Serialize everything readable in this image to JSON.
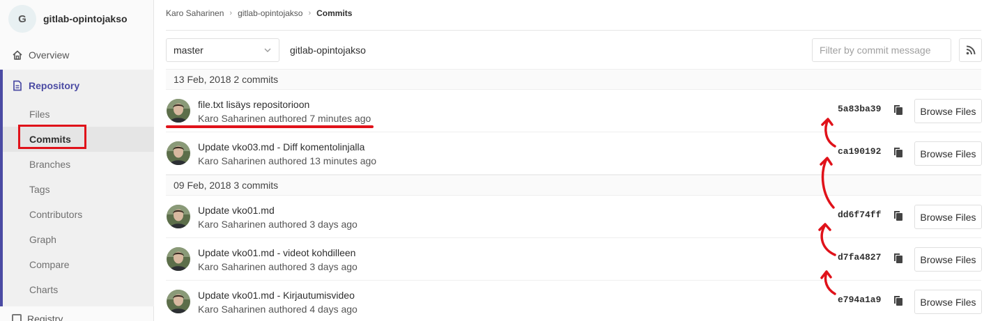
{
  "sidebar": {
    "project_initial": "G",
    "project_name": "gitlab-opintojakso",
    "overview": "Overview",
    "repository": "Repository",
    "items": [
      "Files",
      "Commits",
      "Branches",
      "Tags",
      "Contributors",
      "Graph",
      "Compare",
      "Charts"
    ],
    "next_section": "Registry"
  },
  "breadcrumb": [
    "Karo Saharinen",
    "gitlab-opintojakso",
    "Commits"
  ],
  "toolbar": {
    "branch": "master",
    "repo_path": "gitlab-opintojakso",
    "filter_placeholder": "Filter by commit message"
  },
  "day_groups": [
    {
      "header": "13 Feb, 2018 2 commits",
      "commits": [
        {
          "title": "file.txt lisäys repositorioon",
          "meta": "Karo Saharinen authored 7 minutes ago",
          "sha": "5a83ba39",
          "browse": "Browse Files"
        },
        {
          "title": "Update vko03.md - Diff komentolinjalla",
          "meta": "Karo Saharinen authored 13 minutes ago",
          "sha": "ca190192",
          "browse": "Browse Files"
        }
      ]
    },
    {
      "header": "09 Feb, 2018 3 commits",
      "commits": [
        {
          "title": "Update vko01.md",
          "meta": "Karo Saharinen authored 3 days ago",
          "sha": "dd6f74ff",
          "browse": "Browse Files"
        },
        {
          "title": "Update vko01.md - videot kohdilleen",
          "meta": "Karo Saharinen authored 3 days ago",
          "sha": "d7fa4827",
          "browse": "Browse Files"
        },
        {
          "title": "Update vko01.md - Kirjautumisvideo",
          "meta": "Karo Saharinen authored 4 days ago",
          "sha": "e794a1a9",
          "browse": "Browse Files"
        }
      ]
    }
  ],
  "colors": {
    "accent": "#4b4ba3",
    "annotation": "#e0121a"
  }
}
